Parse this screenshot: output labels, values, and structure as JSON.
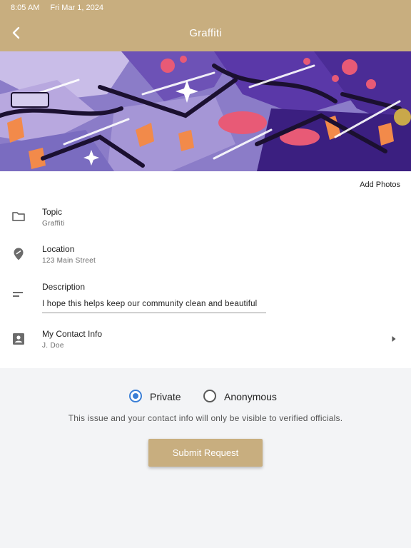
{
  "status_bar": {
    "time": "8:05 AM",
    "date": "Fri Mar 1, 2024"
  },
  "header": {
    "title": "Graffiti",
    "back_icon": "chevron-left-icon"
  },
  "photos": {
    "add_label": "Add Photos"
  },
  "fields": {
    "topic": {
      "label": "Topic",
      "value": "Graffiti",
      "icon": "folder-icon"
    },
    "location": {
      "label": "Location",
      "value": "123 Main Street",
      "icon": "map-pin-icon"
    },
    "description": {
      "label": "Description",
      "value": "I hope this helps keep our community clean and beautiful",
      "icon": "notes-icon"
    },
    "contact": {
      "label": "My Contact Info",
      "value": "J. Doe",
      "icon": "contact-card-icon"
    }
  },
  "visibility": {
    "options": [
      "Private",
      "Anonymous"
    ],
    "selected": "Private",
    "note": "This issue and your contact info will only be visible to verified officials."
  },
  "submit_label": "Submit Request",
  "colors": {
    "accent": "#c8ae7f",
    "radio_selected": "#3b7fd6"
  }
}
